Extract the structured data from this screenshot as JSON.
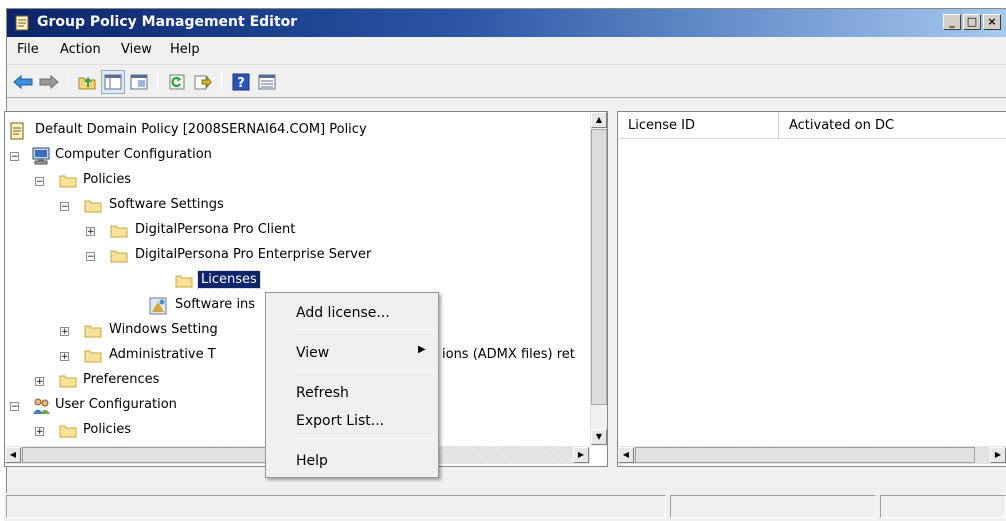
{
  "window": {
    "title": "Group Policy Management Editor"
  },
  "menubar": [
    "File",
    "Action",
    "View",
    "Help"
  ],
  "toolbar_icons": [
    "back-arrow-icon",
    "forward-arrow-icon",
    "up-folder-icon",
    "show-hide-tree-icon",
    "refresh-icon",
    "export-list-icon",
    "help-icon",
    "properties-view-icon"
  ],
  "tree": {
    "root": "Default Domain Policy [2008SERNAI64.COM] Policy",
    "computer_config": "Computer Configuration",
    "policies": "Policies",
    "software_settings": "Software Settings",
    "dp_client": "DigitalPersona Pro Client",
    "dp_server": "DigitalPersona Pro Enterprise Server",
    "licenses": "Licenses",
    "software_install": "Software ins",
    "windows_settings": "Windows Setting",
    "admin_templates": "Administrative T",
    "admin_templates_tail": "ions (ADMX files) ret",
    "preferences": "Preferences",
    "user_config": "User Configuration",
    "user_policies": "Policies"
  },
  "list": {
    "columns": [
      "License ID",
      "Activated on DC"
    ]
  },
  "context_menu": {
    "add_license": "Add license...",
    "view": "View",
    "refresh": "Refresh",
    "export_list": "Export List...",
    "help": "Help"
  },
  "colors": {
    "titlebar": "#0a246a",
    "selection": "#0a246a",
    "chrome": "#f0f0f0"
  }
}
